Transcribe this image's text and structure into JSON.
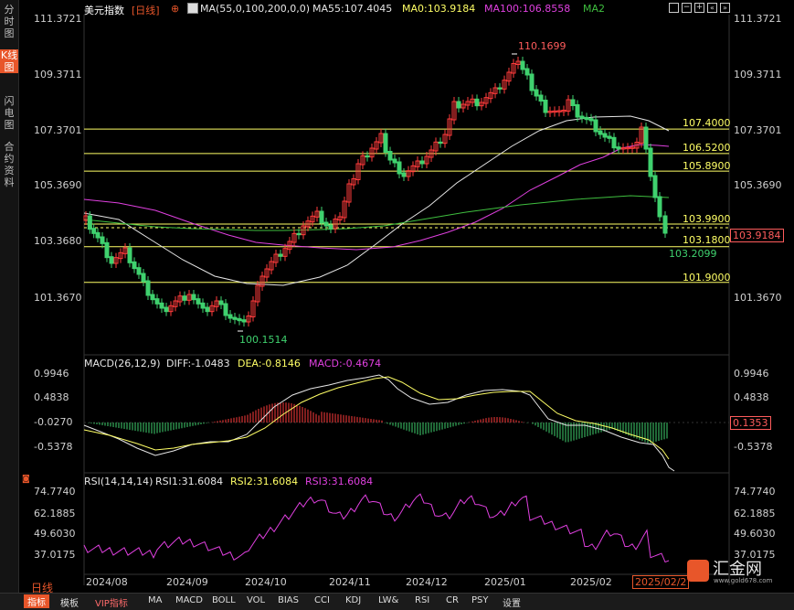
{
  "sidebar": {
    "tabs": [
      {
        "label": "分时图",
        "active": false
      },
      {
        "label": "K线图",
        "active": true
      },
      {
        "label": "闪电图",
        "active": false
      },
      {
        "label": "合约资料",
        "active": false
      }
    ]
  },
  "header": {
    "symbol": "美元指数",
    "period": "[日线]",
    "add_icon": "⊕",
    "ma_params": "MA(55,0,100,200,0,0)",
    "ma55": "MA55:107.4045",
    "ma0": "MA0:103.9184",
    "ma100": "MA100:106.8558",
    "ma2": "MA2",
    "toolbar_icons": [
      "grid-icon",
      "minus-icon",
      "plus-icon",
      "double-left-icon",
      "double-right-icon",
      "left-arrow-icon",
      "right-arrow-icon"
    ]
  },
  "main_axis": {
    "left": [
      "111.3721",
      "109.3711",
      "107.3701",
      "105.3690",
      "103.3680",
      "101.3670"
    ],
    "right": [
      "111.3721",
      "109.3711",
      "107.3701",
      "105.3690",
      "101.3670"
    ],
    "current_price": "103.9184"
  },
  "levels": [
    {
      "label": "107.4000",
      "value": 107.4
    },
    {
      "label": "106.5200",
      "value": 106.52
    },
    {
      "label": "105.8900",
      "value": 105.89
    },
    {
      "label": "103.9900",
      "value": 103.99
    },
    {
      "label": "103.1800",
      "value": 103.18
    },
    {
      "label": "101.9000",
      "value": 101.9
    }
  ],
  "annotations": {
    "high": "110.1699",
    "low": "100.1514",
    "recent_low": "103.2099"
  },
  "macd": {
    "title": "MACD(26,12,9)",
    "diff": "DIFF:-1.0483",
    "dea": "DEA:-0.8146",
    "macd": "MACD:-0.4674",
    "left_axis": [
      "0.9946",
      "0.4838",
      "-0.0270",
      "-0.5378"
    ],
    "right_axis": [
      "0.9946",
      "0.4838",
      "-0.5378"
    ],
    "current": "0.1353"
  },
  "rsi": {
    "title": "RSI(14,14,14)",
    "rsi1": "RSI1:31.6084",
    "rsi2": "RSI2:31.6084",
    "rsi3": "RSI3:31.6084",
    "left_axis": [
      "74.7740",
      "62.1885",
      "49.6030",
      "37.0175"
    ],
    "right_axis": [
      "74.7740",
      "62.1885",
      "49.6030",
      "37.0175"
    ]
  },
  "x_axis": {
    "period_label": "日线",
    "dates": [
      "2024/08",
      "2024/09",
      "2024/10",
      "2024/11",
      "2024/12",
      "2025/01",
      "2025/02"
    ],
    "cursor_date": "2025/02/2"
  },
  "bottom_tabs": [
    "指标",
    "模板",
    "VIP指标",
    "MA",
    "MACD",
    "BOLL",
    "VOL",
    "BIAS",
    "CCI",
    "KDJ",
    "LW&",
    "RSI",
    "CR",
    "PSY",
    "设置"
  ],
  "watermark": {
    "name": "汇金网",
    "url": "www.gold678.com"
  },
  "colors": {
    "up": "#ff3b3b",
    "down": "#3fd16e",
    "level": "#ffff66",
    "ma_white": "#e6e6e6",
    "ma_magenta": "#e040e0",
    "ma_green": "#3fbf3f",
    "accent": "#e8562a"
  }
}
